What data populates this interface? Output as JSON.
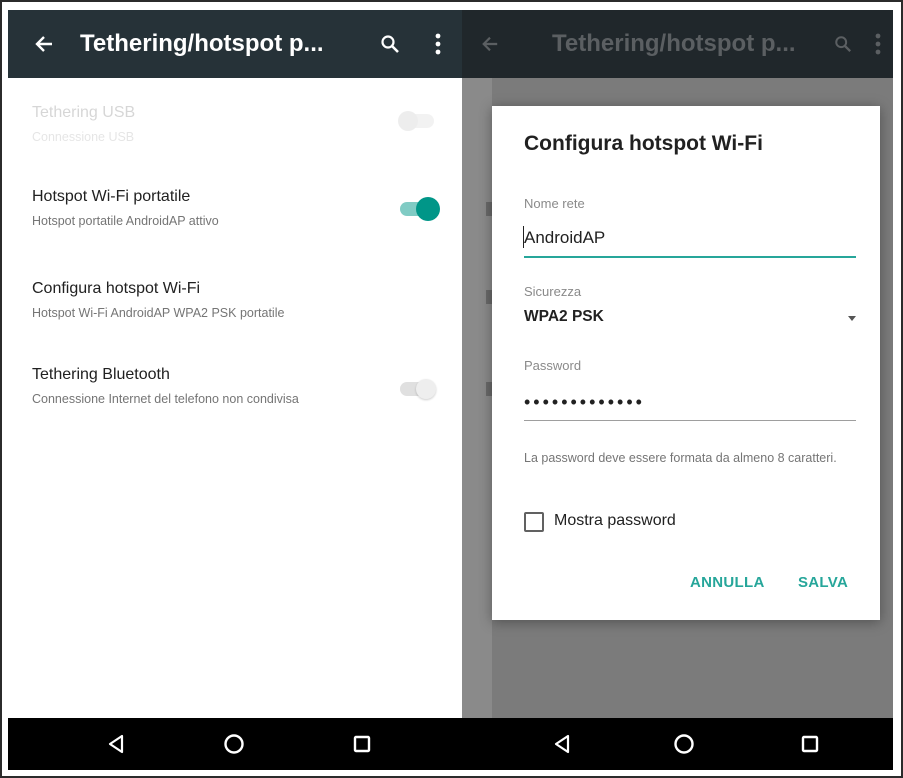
{
  "left": {
    "appbar": {
      "title": "Tethering/hotspot p..."
    },
    "rows": [
      {
        "title": "Tethering USB",
        "subtitle": "Connessione USB",
        "switch": false,
        "faded": true
      },
      {
        "title": "Hotspot Wi-Fi portatile",
        "subtitle": "Hotspot portatile AndroidAP attivo",
        "switch": true
      },
      {
        "title": "Configura hotspot Wi-Fi",
        "subtitle": "Hotspot Wi-Fi AndroidAP WPA2 PSK portatile"
      },
      {
        "title": "Tethering Bluetooth",
        "subtitle": "Connessione Internet del telefono non condivisa",
        "switch": false
      }
    ]
  },
  "right": {
    "appbar": {
      "title": "Tethering/hotspot p..."
    },
    "dialog": {
      "title": "Configura hotspot Wi-Fi",
      "network_label": "Nome rete",
      "network_value": "AndroidAP",
      "security_label": "Sicurezza",
      "security_value": "WPA2 PSK",
      "password_label": "Password",
      "password_value": "•••••••••••••",
      "help_text": "La password deve essere formata da almeno 8 caratteri.",
      "show_password_label": "Mostra password",
      "show_password_checked": false,
      "cancel_label": "ANNULLA",
      "save_label": "SALVA"
    }
  },
  "icons": {
    "back": "arrow-back-icon",
    "search": "search-icon",
    "more": "more-vert-icon",
    "nav_back": "nav-back-triangle-icon",
    "nav_home": "nav-home-circle-icon",
    "nav_recents": "nav-recents-square-icon"
  },
  "colors": {
    "appbar": "#263238",
    "accent": "#26a69a",
    "switch_on_track": "#80cbc4",
    "scrim": "#7b7b7b",
    "navbar": "#000000"
  }
}
